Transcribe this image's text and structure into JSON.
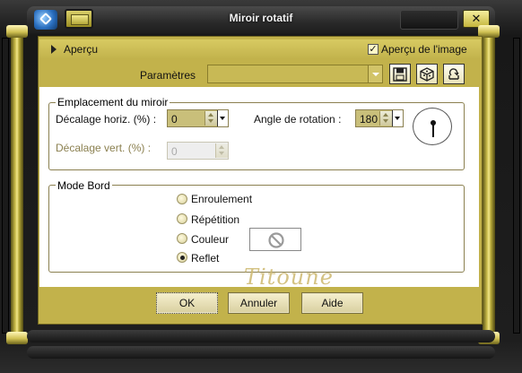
{
  "window": {
    "title": "Miroir rotatif",
    "close_label": "✕"
  },
  "preview": {
    "label": "Aperçu",
    "image_preview_label": "Aperçu de l'image",
    "image_preview_checked": true
  },
  "params": {
    "label": "Paramètres",
    "selected": ""
  },
  "toolbar": {
    "icons": [
      "save-icon",
      "load-preset-icon",
      "reset-icon"
    ]
  },
  "mirror_group": {
    "title": "Emplacement du miroir",
    "h_offset_label": "Décalage horiz. (%) :",
    "h_offset_value": "0",
    "v_offset_label": "Décalage vert. (%) :",
    "v_offset_value": "0",
    "v_offset_enabled": false,
    "angle_label": "Angle de rotation :",
    "angle_value": "180"
  },
  "border_group": {
    "title": "Mode Bord",
    "options": [
      "Enroulement",
      "Répétition",
      "Couleur",
      "Reflet"
    ],
    "selected": "Reflet"
  },
  "watermark": "Titoune",
  "buttons": {
    "ok": "OK",
    "cancel": "Annuler",
    "help": "Aide"
  },
  "colors": {
    "accent_gold": "#c2b24b",
    "frame_dark": "#1a1a1a"
  }
}
